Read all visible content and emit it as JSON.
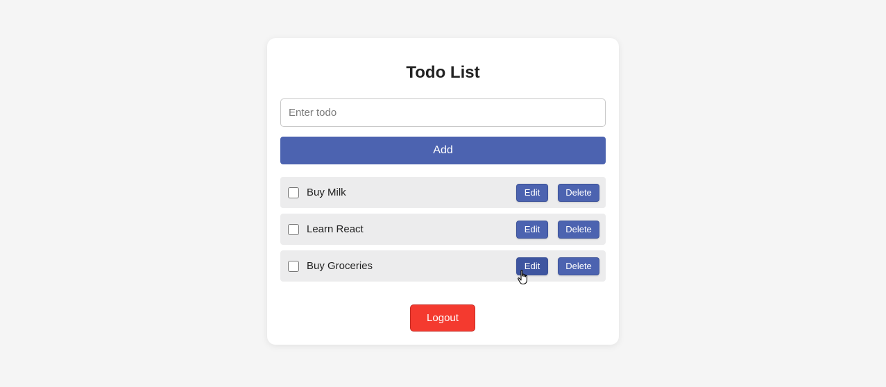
{
  "app": {
    "title": "Todo List"
  },
  "input": {
    "placeholder": "Enter todo",
    "value": ""
  },
  "buttons": {
    "add_label": "Add",
    "edit_label": "Edit",
    "delete_label": "Delete",
    "logout_label": "Logout"
  },
  "todos": [
    {
      "label": "Buy Milk",
      "checked": false
    },
    {
      "label": "Learn React",
      "checked": false
    },
    {
      "label": "Buy Groceries",
      "checked": false
    }
  ],
  "colors": {
    "primary": "#4c63b0",
    "danger": "#f43a2f",
    "item_background": "#ececed",
    "page_background": "#f5f5f5"
  },
  "icons": {
    "cursor": "pointer-hand-icon"
  }
}
